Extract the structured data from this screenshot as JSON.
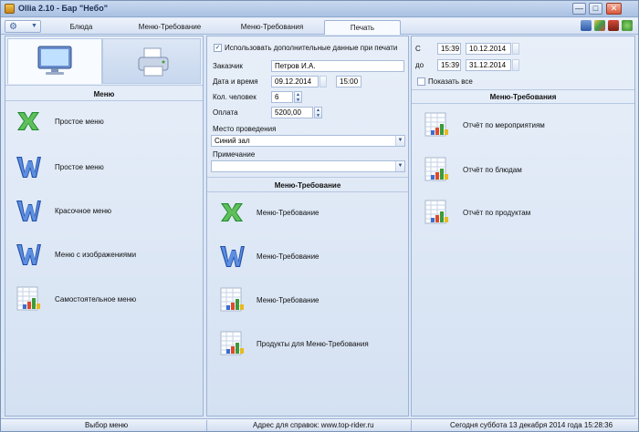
{
  "window": {
    "title": "Ollia 2.10 - Бар \"Небо\"",
    "controls": {
      "minimize": "—",
      "maximize": "□",
      "close": "✕"
    }
  },
  "toolbar": {
    "tools_icon": "tools-icon",
    "tabs": [
      "Блюда",
      "Меню-Требование",
      "Меню-Требования",
      "Печать"
    ],
    "active_tab": "Печать",
    "right_icons": [
      "save-icon",
      "palette-icon",
      "book-icon",
      "help-icon"
    ]
  },
  "left_panel": {
    "heading": "Меню",
    "items": [
      {
        "icon": "excel-icon",
        "label": "Простое меню"
      },
      {
        "icon": "word-icon",
        "label": "Простое меню"
      },
      {
        "icon": "word-icon",
        "label": "Красочное меню"
      },
      {
        "icon": "word-icon",
        "label": "Меню с изображениями"
      },
      {
        "icon": "report-icon",
        "label": "Самостоятельное меню"
      }
    ]
  },
  "middle_panel": {
    "use_extra_label": "Использовать дополнительные данные при печати",
    "use_extra_checked": true,
    "customer_label": "Заказчик",
    "customer_value": "Петров И.А.",
    "datetime_label": "Дата и время",
    "date_value": "09.12.2014",
    "time_value": "15:00",
    "people_label": "Кол. человек",
    "people_value": "6",
    "payment_label": "Оплата",
    "payment_value": "5200,00",
    "place_label": "Место проведения",
    "place_value": "Синий зал",
    "note_label": "Примечание",
    "note_value": "",
    "heading": "Меню-Требование",
    "items": [
      {
        "icon": "excel-icon",
        "label": "Меню-Требование"
      },
      {
        "icon": "word-icon",
        "label": "Меню-Требование"
      },
      {
        "icon": "report-icon",
        "label": "Меню-Требование"
      },
      {
        "icon": "report-icon",
        "label": "Продукты для Меню-Требования"
      }
    ]
  },
  "right_panel": {
    "from_label": "С",
    "from_time": "15:39",
    "from_date": "10.12.2014",
    "to_label": "до",
    "to_time": "15:39",
    "to_date": "31.12.2014",
    "show_all_label": "Показать все",
    "show_all_checked": false,
    "heading": "Меню-Требования",
    "items": [
      {
        "icon": "report-icon",
        "label": "Отчёт по мероприятиям"
      },
      {
        "icon": "report-icon",
        "label": "Отчёт по блюдам"
      },
      {
        "icon": "report-icon",
        "label": "Отчёт по продуктам"
      }
    ]
  },
  "statusbar": {
    "left": "Выбор меню",
    "middle": "Адрес для справок: www.top-rider.ru",
    "right": "Сегодня  суббота  13 декабря 2014 года  15:28:36"
  },
  "colors": {
    "excel_green": "#1e8a2e",
    "word_blue": "#2350a8",
    "accent": "#9db3d6"
  }
}
